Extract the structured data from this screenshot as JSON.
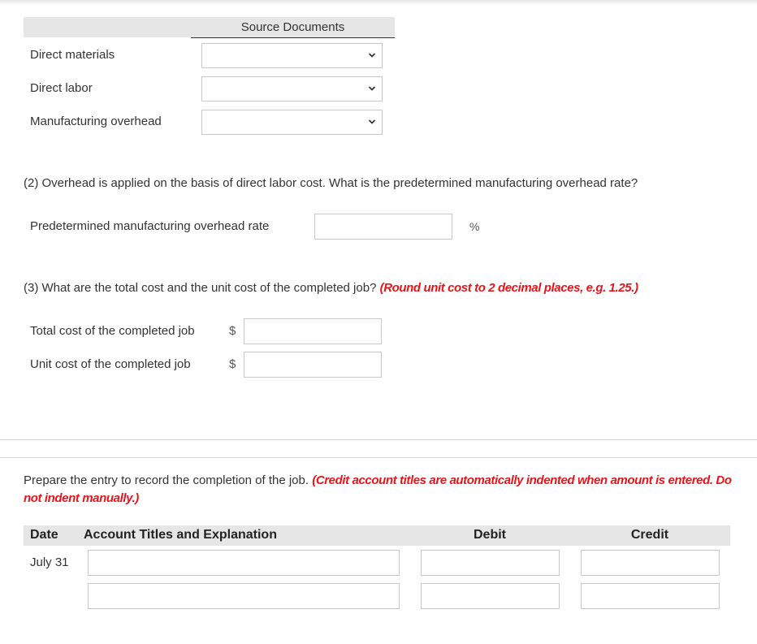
{
  "source_documents": {
    "header": "Source Documents",
    "rows": [
      {
        "label": "Direct materials",
        "selected": ""
      },
      {
        "label": "Direct labor",
        "selected": ""
      },
      {
        "label": "Manufacturing overhead",
        "selected": ""
      }
    ]
  },
  "part2": {
    "question": "(2) Overhead is applied on the basis of direct labor cost. What is the predetermined manufacturing overhead rate?",
    "field_label": "Predetermined manufacturing overhead rate",
    "value": "",
    "unit": "%"
  },
  "part3": {
    "question": "(3) What are the total cost and the unit cost of the completed job?",
    "hint": "(Round unit cost to 2 decimal places, e.g. 1.25.)",
    "fields": [
      {
        "label": "Total cost of the completed job",
        "currency": "$",
        "value": ""
      },
      {
        "label": "Unit cost of the completed job",
        "currency": "$",
        "value": ""
      }
    ]
  },
  "journal": {
    "instruction": "Prepare the entry to record the completion of the job.",
    "hint": "(Credit account titles are automatically indented when amount is entered. Do not indent manually.)",
    "columns": [
      "Date",
      "Account Titles and Explanation",
      "Debit",
      "Credit"
    ],
    "rows": [
      {
        "date": "July 31",
        "account": "",
        "debit": "",
        "credit": ""
      },
      {
        "date": "",
        "account": "",
        "debit": "",
        "credit": ""
      }
    ]
  },
  "colors": {
    "hint_red": "#e8141b",
    "header_band": "#e6e6e6"
  }
}
